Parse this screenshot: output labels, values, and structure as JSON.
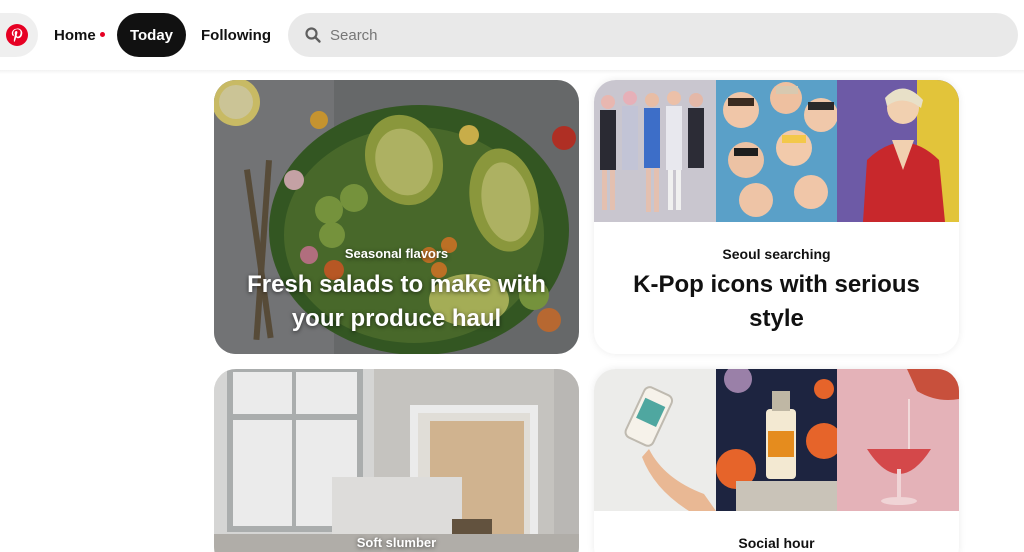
{
  "header": {
    "logo_icon": "pinterest-logo-icon",
    "nav": {
      "home": "Home",
      "today": "Today",
      "following": "Following"
    },
    "search": {
      "placeholder": "Search",
      "icon": "search-icon"
    }
  },
  "colors": {
    "brand": "#e60023",
    "active_tab": "#111111",
    "search_bg": "#e9e9e9"
  },
  "cards": [
    {
      "eyebrow": "Seasonal flavors",
      "headline_line1": "Fresh salads to make with",
      "headline_line2": "your produce haul"
    },
    {
      "eyebrow": "Seoul searching",
      "headline_line1": "K-Pop icons with serious",
      "headline_line2": "style"
    },
    {
      "eyebrow": "Soft slumber"
    },
    {
      "eyebrow": "Social hour"
    }
  ]
}
